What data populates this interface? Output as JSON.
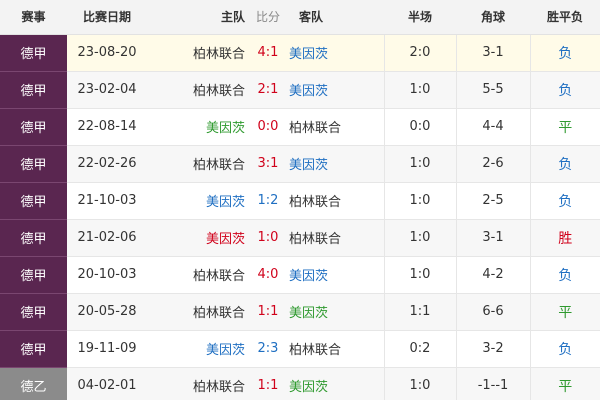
{
  "header": {
    "league": "赛事",
    "date": "比赛日期",
    "home": "主队",
    "score": "比分",
    "away": "客队",
    "half": "半场",
    "corner": "角球",
    "result": "胜平负"
  },
  "colors": {
    "league_bg": "#5a2650",
    "league_alt_bg": "#8b8b8b",
    "red": "#d0021b",
    "blue": "#1f6fc2",
    "green": "#2f9a2f",
    "highlight_row": "#fffbe8"
  },
  "rows": [
    {
      "league": "德甲",
      "date": "23-08-20",
      "home": "柏林联合",
      "score": "4:1",
      "away": "美因茨",
      "half": "2:0",
      "corner": "3-1",
      "result": "负"
    },
    {
      "league": "德甲",
      "date": "23-02-04",
      "home": "柏林联合",
      "score": "2:1",
      "away": "美因茨",
      "half": "1:0",
      "corner": "5-5",
      "result": "负"
    },
    {
      "league": "德甲",
      "date": "22-08-14",
      "home": "美因茨",
      "score": "0:0",
      "away": "柏林联合",
      "half": "0:0",
      "corner": "4-4",
      "result": "平"
    },
    {
      "league": "德甲",
      "date": "22-02-26",
      "home": "柏林联合",
      "score": "3:1",
      "away": "美因茨",
      "half": "1:0",
      "corner": "2-6",
      "result": "负"
    },
    {
      "league": "德甲",
      "date": "21-10-03",
      "home": "美因茨",
      "score": "1:2",
      "away": "柏林联合",
      "half": "1:0",
      "corner": "2-5",
      "result": "负"
    },
    {
      "league": "德甲",
      "date": "21-02-06",
      "home": "美因茨",
      "score": "1:0",
      "away": "柏林联合",
      "half": "1:0",
      "corner": "3-1",
      "result": "胜"
    },
    {
      "league": "德甲",
      "date": "20-10-03",
      "home": "柏林联合",
      "score": "4:0",
      "away": "美因茨",
      "half": "1:0",
      "corner": "4-2",
      "result": "负"
    },
    {
      "league": "德甲",
      "date": "20-05-28",
      "home": "柏林联合",
      "score": "1:1",
      "away": "美因茨",
      "half": "1:1",
      "corner": "6-6",
      "result": "平"
    },
    {
      "league": "德甲",
      "date": "19-11-09",
      "home": "美因茨",
      "score": "2:3",
      "away": "柏林联合",
      "half": "0:2",
      "corner": "3-2",
      "result": "负"
    },
    {
      "league": "德乙",
      "date": "04-02-01",
      "home": "柏林联合",
      "score": "1:1",
      "away": "美因茨",
      "half": "1:0",
      "corner": "-1--1",
      "result": "平"
    }
  ]
}
